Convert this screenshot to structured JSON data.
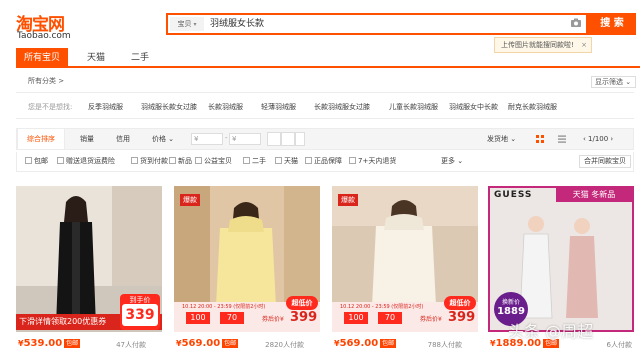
{
  "logo": {
    "cn": "淘宝网",
    "en": "Taobao.com"
  },
  "search": {
    "type_label": "宝贝",
    "query": "羽绒服女长款",
    "button_label": "搜 索",
    "tooltip": "上传图片就能搜同款啦!",
    "tooltip_close": "×"
  },
  "tabs": [
    {
      "label": "所有宝贝"
    },
    {
      "label": "天猫"
    },
    {
      "label": "二手"
    }
  ],
  "category": {
    "all_label": "所有分类 >",
    "filter_label": "显示筛选 ⌄"
  },
  "suggestions": {
    "label": "您是不是想找:",
    "items": [
      "反季羽绒服",
      "羽绒服长款女过膝",
      "长款羽绒服",
      "轻薄羽绒服",
      "长款羽绒服女过膝",
      "儿童长款羽绒服",
      "羽绒服女中长款",
      "耐克长款羽绒服"
    ]
  },
  "sort": {
    "items": [
      "综合排序",
      "销量",
      "信用",
      "价格 ⌄"
    ],
    "price_from": "¥",
    "price_to": "¥",
    "price_sep": "-",
    "ship_from": "发货地 ⌄",
    "pager": "‹ 1/100 ›"
  },
  "checks": [
    "包邮",
    "赠送退货运费险",
    "货到付款",
    "新品",
    "公益宝贝",
    "二手",
    "天猫",
    "正品保障",
    "7+天内退货"
  ],
  "more_label": "更多 ⌄",
  "merge_label": "合并同款宝贝",
  "products": [
    {
      "price": "539.00",
      "badge": "包邮",
      "paid": "47人付款",
      "banner": "下滑详情领取200优惠券",
      "promo_top": "到手价",
      "promo_price": "339"
    },
    {
      "price": "569.00",
      "badge": "包邮",
      "paid": "2820人付款",
      "tag": "爆款",
      "promo_date": "10.12 20:00 - 23:59 (仅限前2小时)",
      "promo_coupon1": "100",
      "promo_coupon2": "70",
      "promo_final_label": "券后价¥",
      "promo_price": "399",
      "promo_badge": "超低价"
    },
    {
      "price": "569.00",
      "badge": "包邮",
      "paid": "788人付款",
      "tag": "爆款",
      "promo_date": "10.12 20:00 - 23:59 (仅限前2小时)",
      "promo_coupon1": "100",
      "promo_coupon2": "70",
      "promo_final_label": "券后价¥",
      "promo_price": "399",
      "promo_badge": "超低价"
    },
    {
      "price": "1889.00",
      "badge": "包邮",
      "paid": "6人付款",
      "brand": "GUESS",
      "promo_top": "天猫 冬新品",
      "promo_label": "换新价",
      "promo_price": "1889"
    }
  ],
  "watermark": "头条 @周超",
  "colors": {
    "brand": "#ff5000",
    "price": "#ff4400"
  }
}
